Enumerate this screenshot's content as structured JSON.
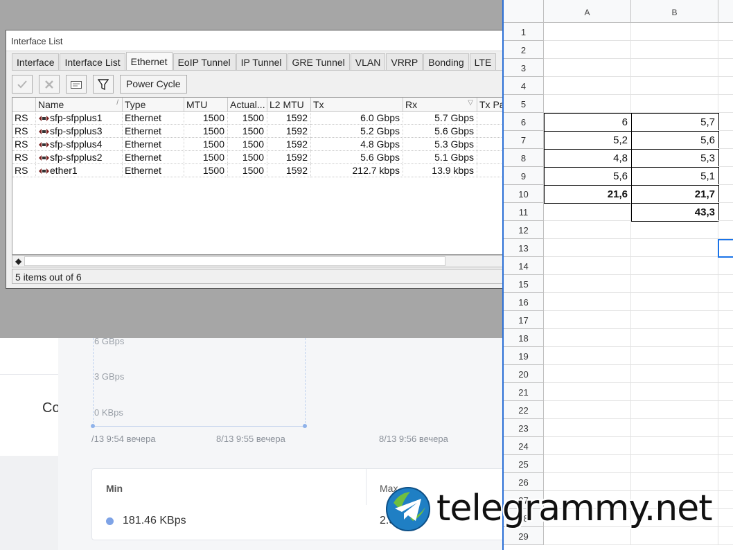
{
  "window": {
    "title": "Interface List",
    "tabs": [
      "Interface",
      "Interface List",
      "Ethernet",
      "EoIP Tunnel",
      "IP Tunnel",
      "GRE Tunnel",
      "VLAN",
      "VRRP",
      "Bonding",
      "LTE"
    ],
    "active_tab": "Ethernet",
    "toolbar": {
      "enable_icon": "check-icon",
      "disable_icon": "cross-icon",
      "comment_icon": "note-icon",
      "filter_icon": "filter-icon",
      "power_cycle_label": "Power Cycle"
    },
    "columns": [
      "",
      "Name",
      "Type",
      "MTU",
      "Actual...",
      "L2 MTU",
      "Tx",
      "Rx",
      "Tx Pa"
    ],
    "rows": [
      {
        "flags": "RS",
        "name": "sfp-sfpplus1",
        "type": "Ethernet",
        "mtu": "1500",
        "actual": "1500",
        "l2mtu": "1592",
        "tx": "6.0 Gbps",
        "rx": "5.7 Gbps"
      },
      {
        "flags": "RS",
        "name": "sfp-sfpplus3",
        "type": "Ethernet",
        "mtu": "1500",
        "actual": "1500",
        "l2mtu": "1592",
        "tx": "5.2 Gbps",
        "rx": "5.6 Gbps"
      },
      {
        "flags": "RS",
        "name": "sfp-sfpplus4",
        "type": "Ethernet",
        "mtu": "1500",
        "actual": "1500",
        "l2mtu": "1592",
        "tx": "4.8 Gbps",
        "rx": "5.3 Gbps"
      },
      {
        "flags": "RS",
        "name": "sfp-sfpplus2",
        "type": "Ethernet",
        "mtu": "1500",
        "actual": "1500",
        "l2mtu": "1592",
        "tx": "5.6 Gbps",
        "rx": "5.1 Gbps"
      },
      {
        "flags": "RS",
        "name": "ether1",
        "type": "Ethernet",
        "mtu": "1500",
        "actual": "1500",
        "l2mtu": "1592",
        "tx": "212.7 kbps",
        "rx": "13.9 kbps"
      }
    ],
    "status": "5 items out of 6"
  },
  "background": {
    "cut_text": "Co",
    "y_ticks": [
      "6 GBps",
      "3 GBps",
      "0 KBps"
    ],
    "x_ticks": [
      "/13 9:54 вечера",
      "8/13 9:55 вечера",
      "8/13 9:56 вечера"
    ],
    "min_label": "Min",
    "max_label": "Max",
    "min_value": "181.46 KBps",
    "max_value": "2.5"
  },
  "sheet": {
    "columns": [
      "A",
      "B"
    ],
    "row_numbers": [
      "1",
      "2",
      "3",
      "4",
      "5",
      "6",
      "7",
      "8",
      "9",
      "10",
      "11",
      "12",
      "13",
      "14",
      "15",
      "16",
      "17",
      "18",
      "19",
      "20",
      "21",
      "22",
      "23",
      "24",
      "25",
      "26",
      "27",
      "28",
      "29"
    ],
    "cells": {
      "a6": "6",
      "b6": "5,7",
      "a7": "5,2",
      "b7": "5,6",
      "a8": "4,8",
      "b8": "5,3",
      "a9": "5,6",
      "b9": "5,1",
      "a10": "21,6",
      "b10": "21,7",
      "b11": "43,3"
    },
    "selection_color": "#1a73e8"
  },
  "watermark": {
    "text": "telegrammy.net",
    "logo_icon": "telegram-plane-icon"
  }
}
